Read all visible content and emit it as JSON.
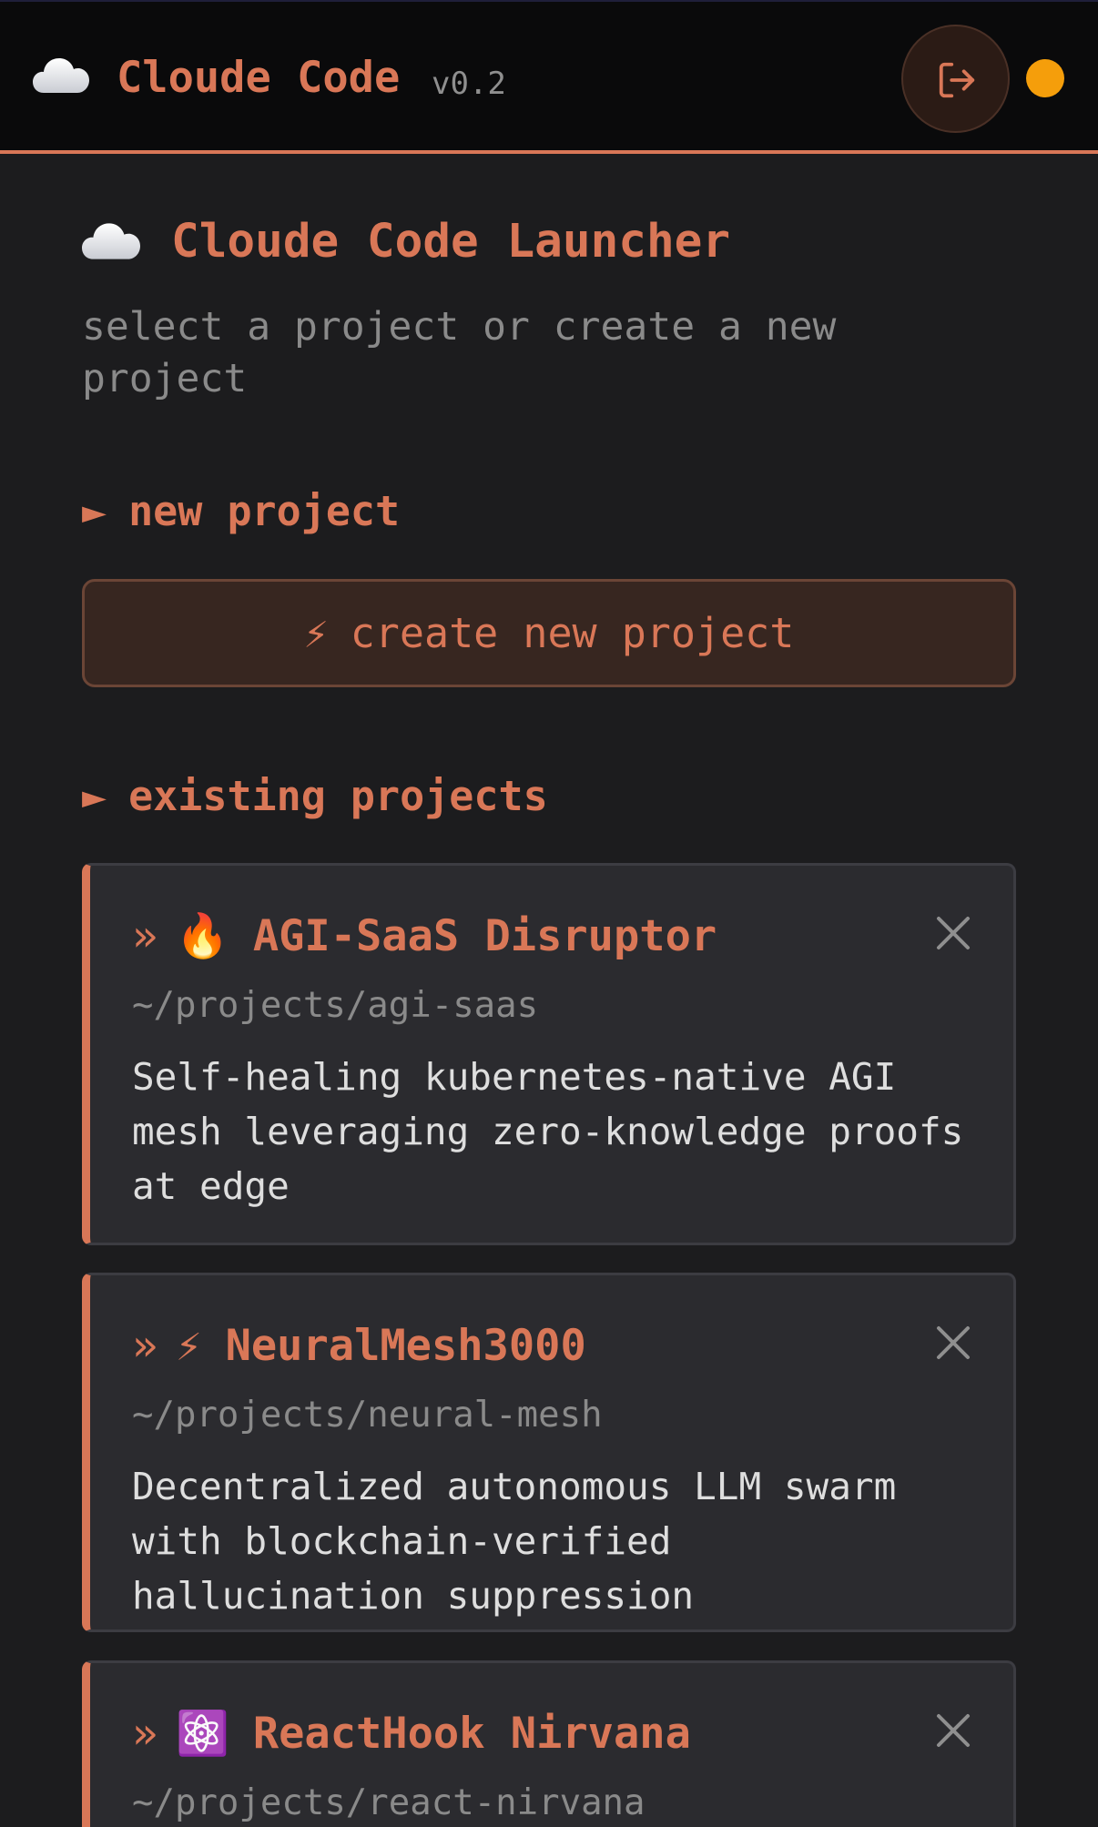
{
  "app": {
    "name": "Cloude Code",
    "version": "v0.2",
    "cloud_icon": "cloud-icon",
    "logout_icon": "logout-icon",
    "status_color": "#f59e0b",
    "accent_color": "#d97757"
  },
  "launcher": {
    "title": "Cloude Code Launcher",
    "subtitle": "select a project or create a new project"
  },
  "sections": {
    "new_project_label": "new project",
    "existing_projects_label": "existing projects",
    "arrow_glyph": "►"
  },
  "create_button": {
    "icon": "⚡",
    "label": "create new project"
  },
  "projects": [
    {
      "chevron": "»",
      "emoji": "🔥",
      "name": "AGI-SaaS Disruptor",
      "path": "~/projects/agi-saas",
      "description": "Self-healing kubernetes-native AGI mesh leveraging zero-knowledge proofs at edge"
    },
    {
      "chevron": "»",
      "emoji": "⚡",
      "name": "NeuralMesh3000",
      "path": "~/projects/neural-mesh",
      "description": "Decentralized autonomous LLM swarm with blockchain-verified hallucination suppression"
    },
    {
      "chevron": "»",
      "emoji": "⚛️",
      "name": "ReactHook Nirvana",
      "path": "~/projects/react-nirvana",
      "description": ""
    }
  ]
}
